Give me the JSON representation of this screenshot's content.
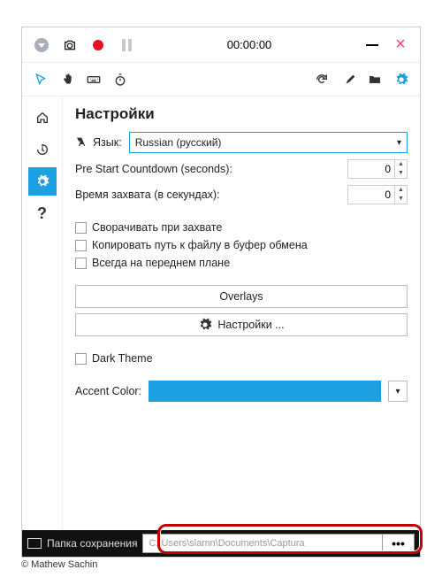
{
  "titlebar": {
    "timer": "00:00:00"
  },
  "settings": {
    "title": "Настройки",
    "language_label": "Язык:",
    "language_value": "Russian (русский)",
    "pre_start": {
      "label": "Pre Start Countdown (seconds):",
      "value": "0"
    },
    "capture_time": {
      "label": "Время захвата (в секундах):",
      "value": "0"
    },
    "minimize_on_capture": "Сворачивать при захвате",
    "copy_path": "Копировать путь к файлу в буфер обмена",
    "always_on_top": "Всегда на переднем плане",
    "overlays_btn": "Overlays",
    "settings_btn": "Настройки ...",
    "dark_theme": "Dark Theme",
    "accent_label": "Accent Color:",
    "accent_value": "#1ba1e2"
  },
  "statusbar": {
    "label": "Папка сохранения",
    "path": "C:\\Users\\slamn\\Documents\\Captura"
  },
  "copyright": "© Mathew Sachin"
}
